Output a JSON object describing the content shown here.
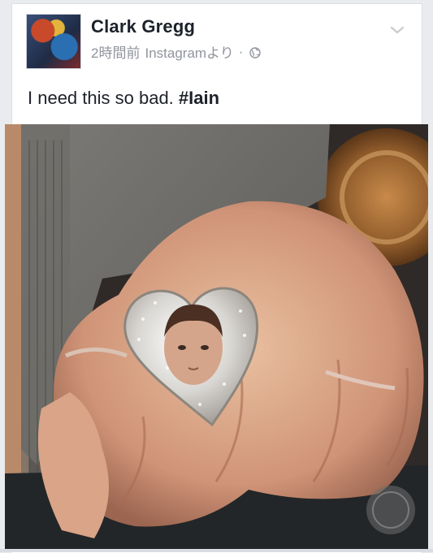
{
  "post": {
    "author": "Clark Gregg",
    "time": "2時間前",
    "source": "Instagramより",
    "separator": "·",
    "text_prefix": "I need this so bad. ",
    "hashtag": "#Iain"
  },
  "icons": {
    "menu": "chevron-down-icon",
    "privacy": "globe-icon",
    "avatar": "avatar"
  },
  "colors": {
    "author": "#1d2129",
    "meta": "#90949c",
    "background": "#e9ebee"
  }
}
